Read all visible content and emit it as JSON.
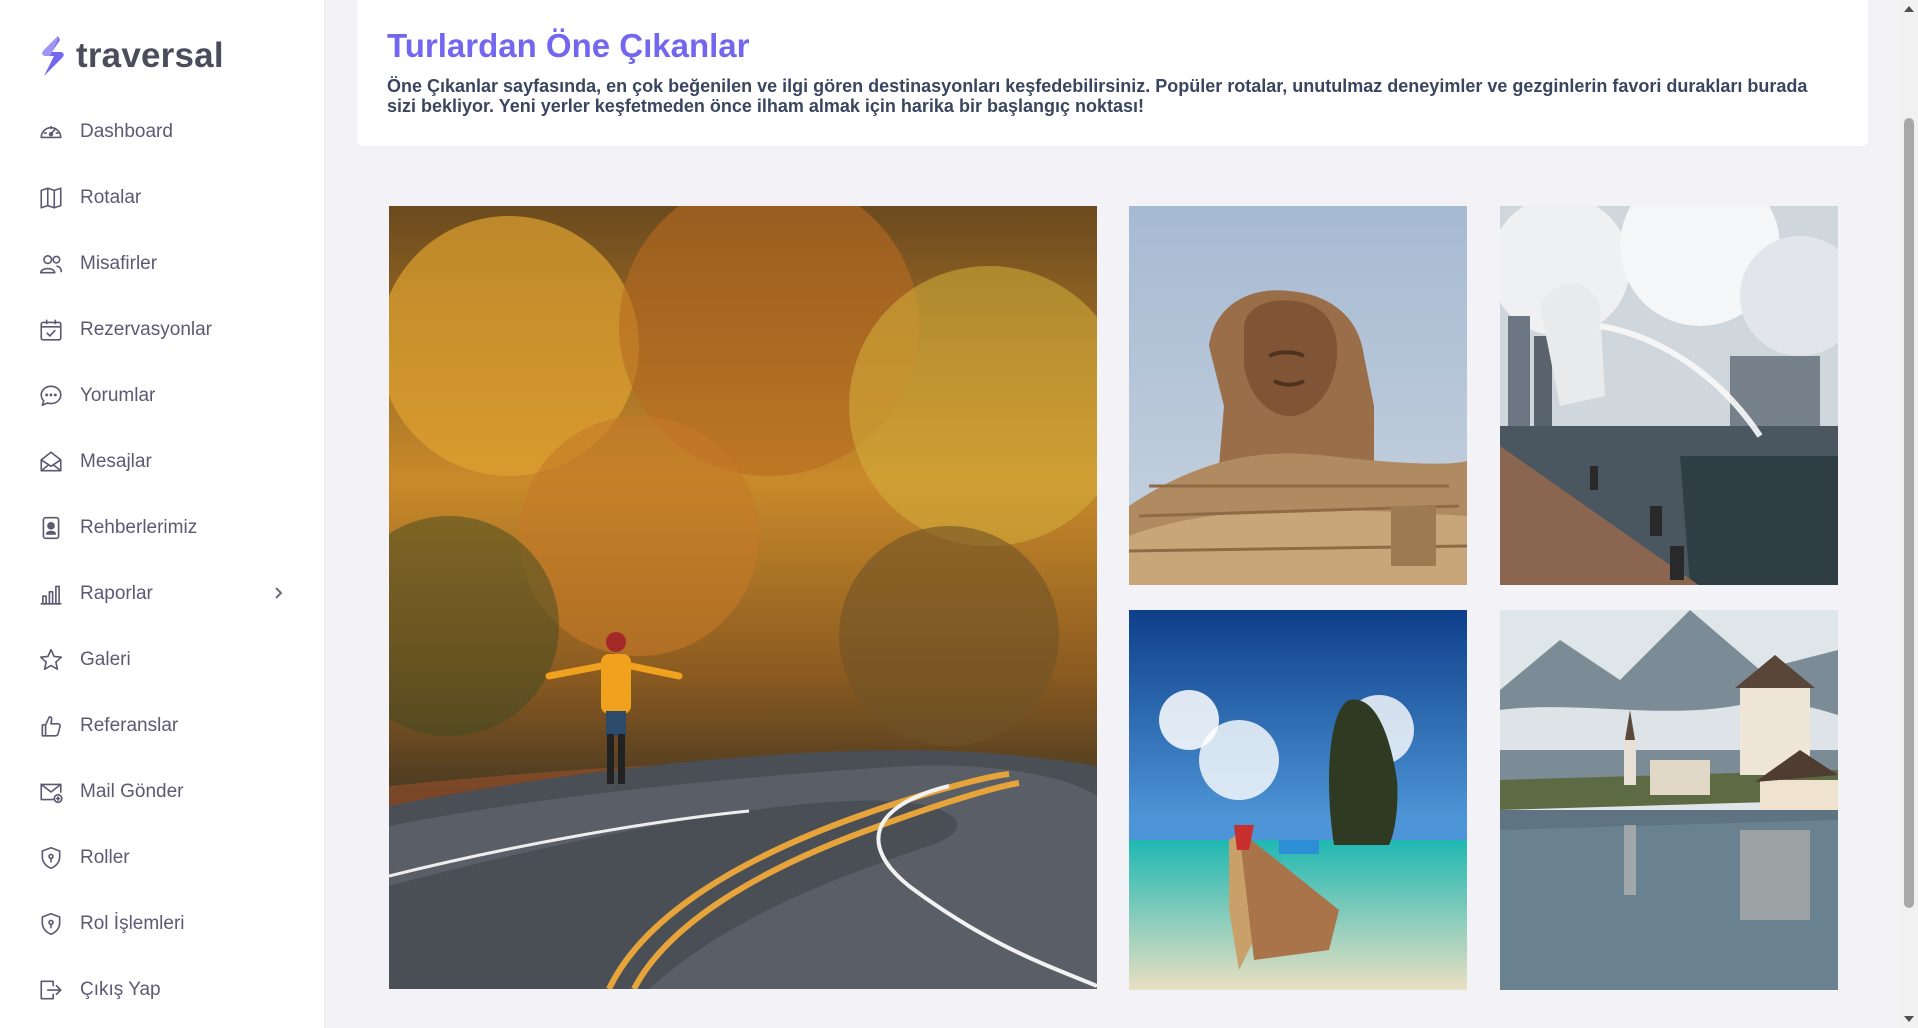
{
  "brand": {
    "name": "traversal",
    "logo_icon": "bolt-s-logo",
    "accent": "#7367f0"
  },
  "sidebar": {
    "items": [
      {
        "label": "Dashboard",
        "icon": "speedometer-icon"
      },
      {
        "label": "Rotalar",
        "icon": "map-icon"
      },
      {
        "label": "Misafirler",
        "icon": "users-icon"
      },
      {
        "label": "Rezervasyonlar",
        "icon": "calendar-check-icon"
      },
      {
        "label": "Yorumlar",
        "icon": "chat-icon"
      },
      {
        "label": "Mesajlar",
        "icon": "envelope-open-icon"
      },
      {
        "label": "Rehberlerimiz",
        "icon": "id-badge-icon"
      },
      {
        "label": "Raporlar",
        "icon": "bar-chart-icon",
        "has_submenu": true
      },
      {
        "label": "Galeri",
        "icon": "star-icon"
      },
      {
        "label": "Referanslar",
        "icon": "thumb-up-icon"
      },
      {
        "label": "Mail Gönder",
        "icon": "mail-send-icon"
      },
      {
        "label": "Roller",
        "icon": "shield-icon"
      },
      {
        "label": "Rol İşlemleri",
        "icon": "shield-lock-icon"
      },
      {
        "label": "Çıkış Yap",
        "icon": "logout-icon"
      }
    ]
  },
  "header": {
    "title": "Turlardan Öne Çıkanlar",
    "description": "Öne Çıkanlar sayfasında, en çok beğenilen ve ilgi gören destinasyonları keşfedebilirsiniz. Popüler rotalar, unutulmaz deneyimler ve gezginlerin favori durakları burada sizi bekliyor. Yeni yerler keşfetmeden önce ilham almak için harika bir başlangıç noktası!"
  },
  "gallery": {
    "images": [
      {
        "subject": "autumn-forest-road"
      },
      {
        "subject": "sphinx-egypt"
      },
      {
        "subject": "merlion-singapore"
      },
      {
        "subject": "tropical-beach-boat"
      },
      {
        "subject": "hallstatt-lake-village"
      }
    ]
  }
}
